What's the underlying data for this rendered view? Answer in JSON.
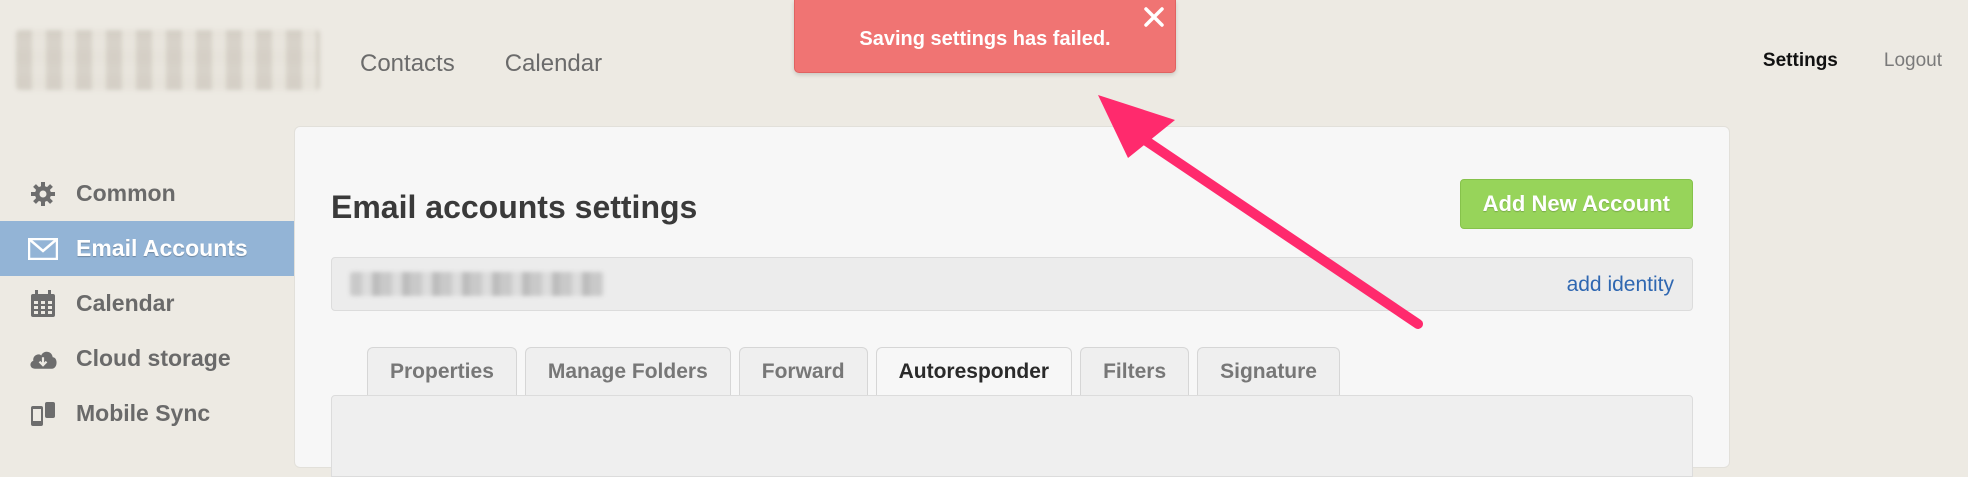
{
  "header": {
    "nav": [
      "Contacts",
      "Calendar"
    ],
    "settings_label": "Settings",
    "logout_label": "Logout"
  },
  "toast": {
    "message": "Saving settings has failed.",
    "icon": "close-icon",
    "color": "#f07473"
  },
  "sidebar": {
    "items": [
      {
        "label": "Common",
        "icon": "gear-icon"
      },
      {
        "label": "Email Accounts",
        "icon": "envelope-icon"
      },
      {
        "label": "Calendar",
        "icon": "calendar-icon"
      },
      {
        "label": "Cloud storage",
        "icon": "cloud-download-icon"
      },
      {
        "label": "Mobile Sync",
        "icon": "mobile-sync-icon"
      }
    ],
    "active": "Email Accounts",
    "active_color": "#93b4d6"
  },
  "main": {
    "title": "Email accounts settings",
    "add_button": "Add New Account",
    "add_button_color": "#97d45a",
    "add_identity": "add identity",
    "tabs": [
      "Properties",
      "Manage Folders",
      "Forward",
      "Autoresponder",
      "Filters",
      "Signature"
    ],
    "active_tab": "Autoresponder"
  },
  "annotation": {
    "icon": "arrow-annotation",
    "color": "#ff2a6d"
  }
}
